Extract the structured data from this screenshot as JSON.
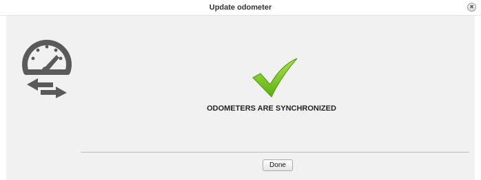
{
  "dialog": {
    "title": "Update odometer",
    "close_label": "×"
  },
  "main": {
    "status_message": "ODOMETERS ARE SYNCHRONIZED",
    "done_label": "Done"
  },
  "icons": {
    "logo": "odometer-sync-icon",
    "status": "checkmark-icon"
  },
  "colors": {
    "content_bg": "#f1f1f1",
    "logo_gray": "#5a5a5a",
    "check_green": "#7ccd22"
  }
}
